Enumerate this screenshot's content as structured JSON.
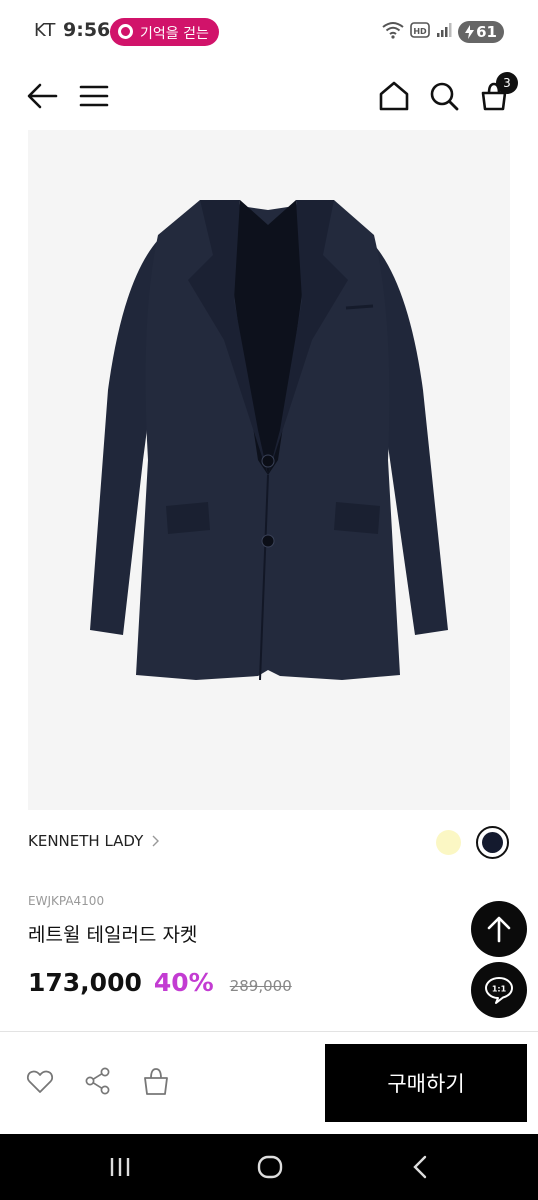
{
  "status_bar": {
    "carrier": "KT",
    "time": "9:56",
    "notification": "기억을 걷는",
    "battery": "61",
    "hd_label": "HD"
  },
  "header": {
    "cart_count": "3"
  },
  "product": {
    "brand": "KENNETH LADY",
    "code": "EWJKPA4100",
    "name": "레트윌 테일러드 자켓",
    "sale_price": "173,000",
    "discount": "40%",
    "original_price": "289,000",
    "colors": [
      {
        "name": "yellow",
        "hex": "#fbf7c4"
      },
      {
        "name": "navy",
        "hex": "#141a2e",
        "selected": true
      }
    ]
  },
  "floating": {
    "chat_label": "1:1"
  },
  "actions": {
    "buy_label": "구매하기"
  },
  "icons": [
    "back-arrow-icon",
    "menu-icon",
    "home-icon",
    "search-icon",
    "cart-icon",
    "chevron-right-icon",
    "arrow-up-icon",
    "chat-icon",
    "heart-icon",
    "share-icon",
    "shopping-bag-icon",
    "recent-apps-icon",
    "home-circle-icon",
    "nav-back-icon"
  ],
  "colors": {
    "accent_discount": "#c33cd2",
    "notification_pill": "#d1136a"
  }
}
